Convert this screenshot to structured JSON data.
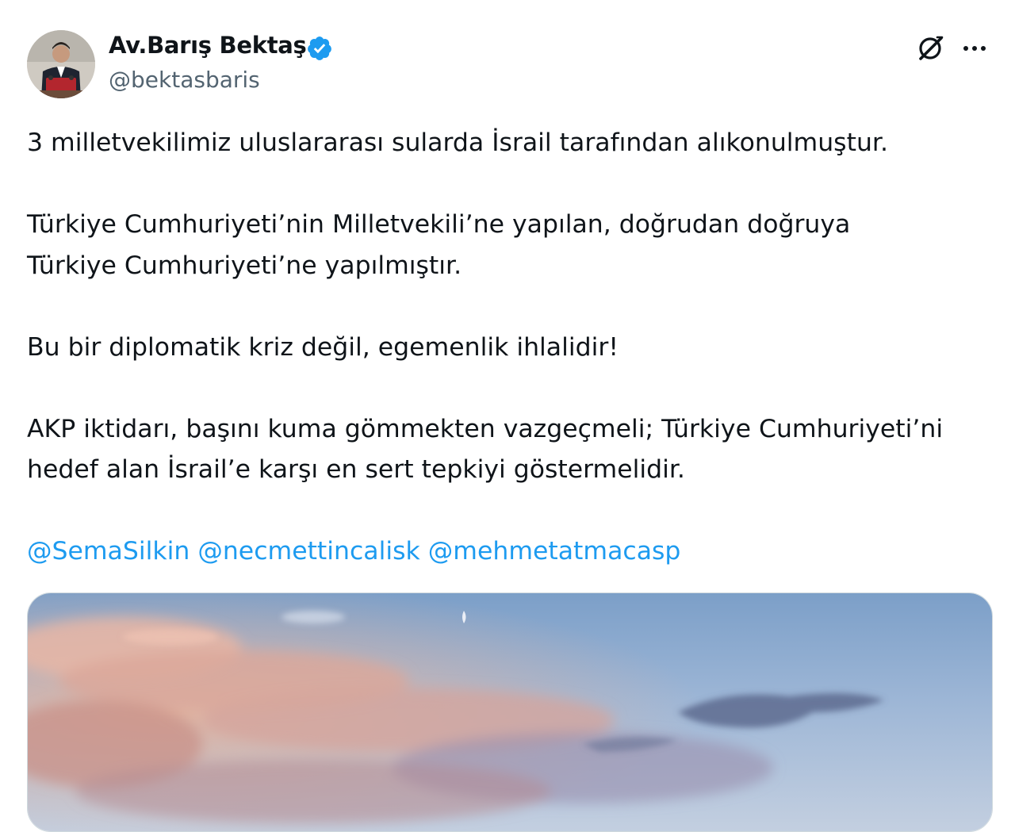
{
  "author": {
    "display_name": "Av.Barış Bektaş",
    "handle": "@bektasbaris",
    "verified": true,
    "verified_color": "#1d9bf0",
    "avatar_icon": "profile-photo"
  },
  "actions": {
    "grok_icon": "grok-icon",
    "more_icon": "more-horizontal-icon"
  },
  "tweet": {
    "paragraphs": [
      [
        "3 milletvekilimiz uluslararası sularda İsrail tarafından alıkonulmuştur."
      ],
      [
        "Türkiye Cumhuriyeti’nin Milletvekili’ne yapılan, doğrudan doğruya",
        "Türkiye Cumhuriyeti’ne yapılmıştır."
      ],
      [
        "Bu bir diplomatik kriz değil, egemenlik ihlalidir!"
      ],
      [
        "AKP iktidarı, başını kuma gömmekten vazgeçmeli; Türkiye Cumhuriyeti’ni",
        "hedef alan İsrail’e karşı en sert tepkiyi göstermelidir."
      ]
    ],
    "mentions": [
      "@SemaSilkin",
      "@necmettincalisk",
      "@mehmetatmacasp"
    ]
  },
  "colors": {
    "text": "#0f1419",
    "secondary": "#536471",
    "link": "#1d9bf0"
  },
  "media": {
    "icon": "sky-photo"
  }
}
